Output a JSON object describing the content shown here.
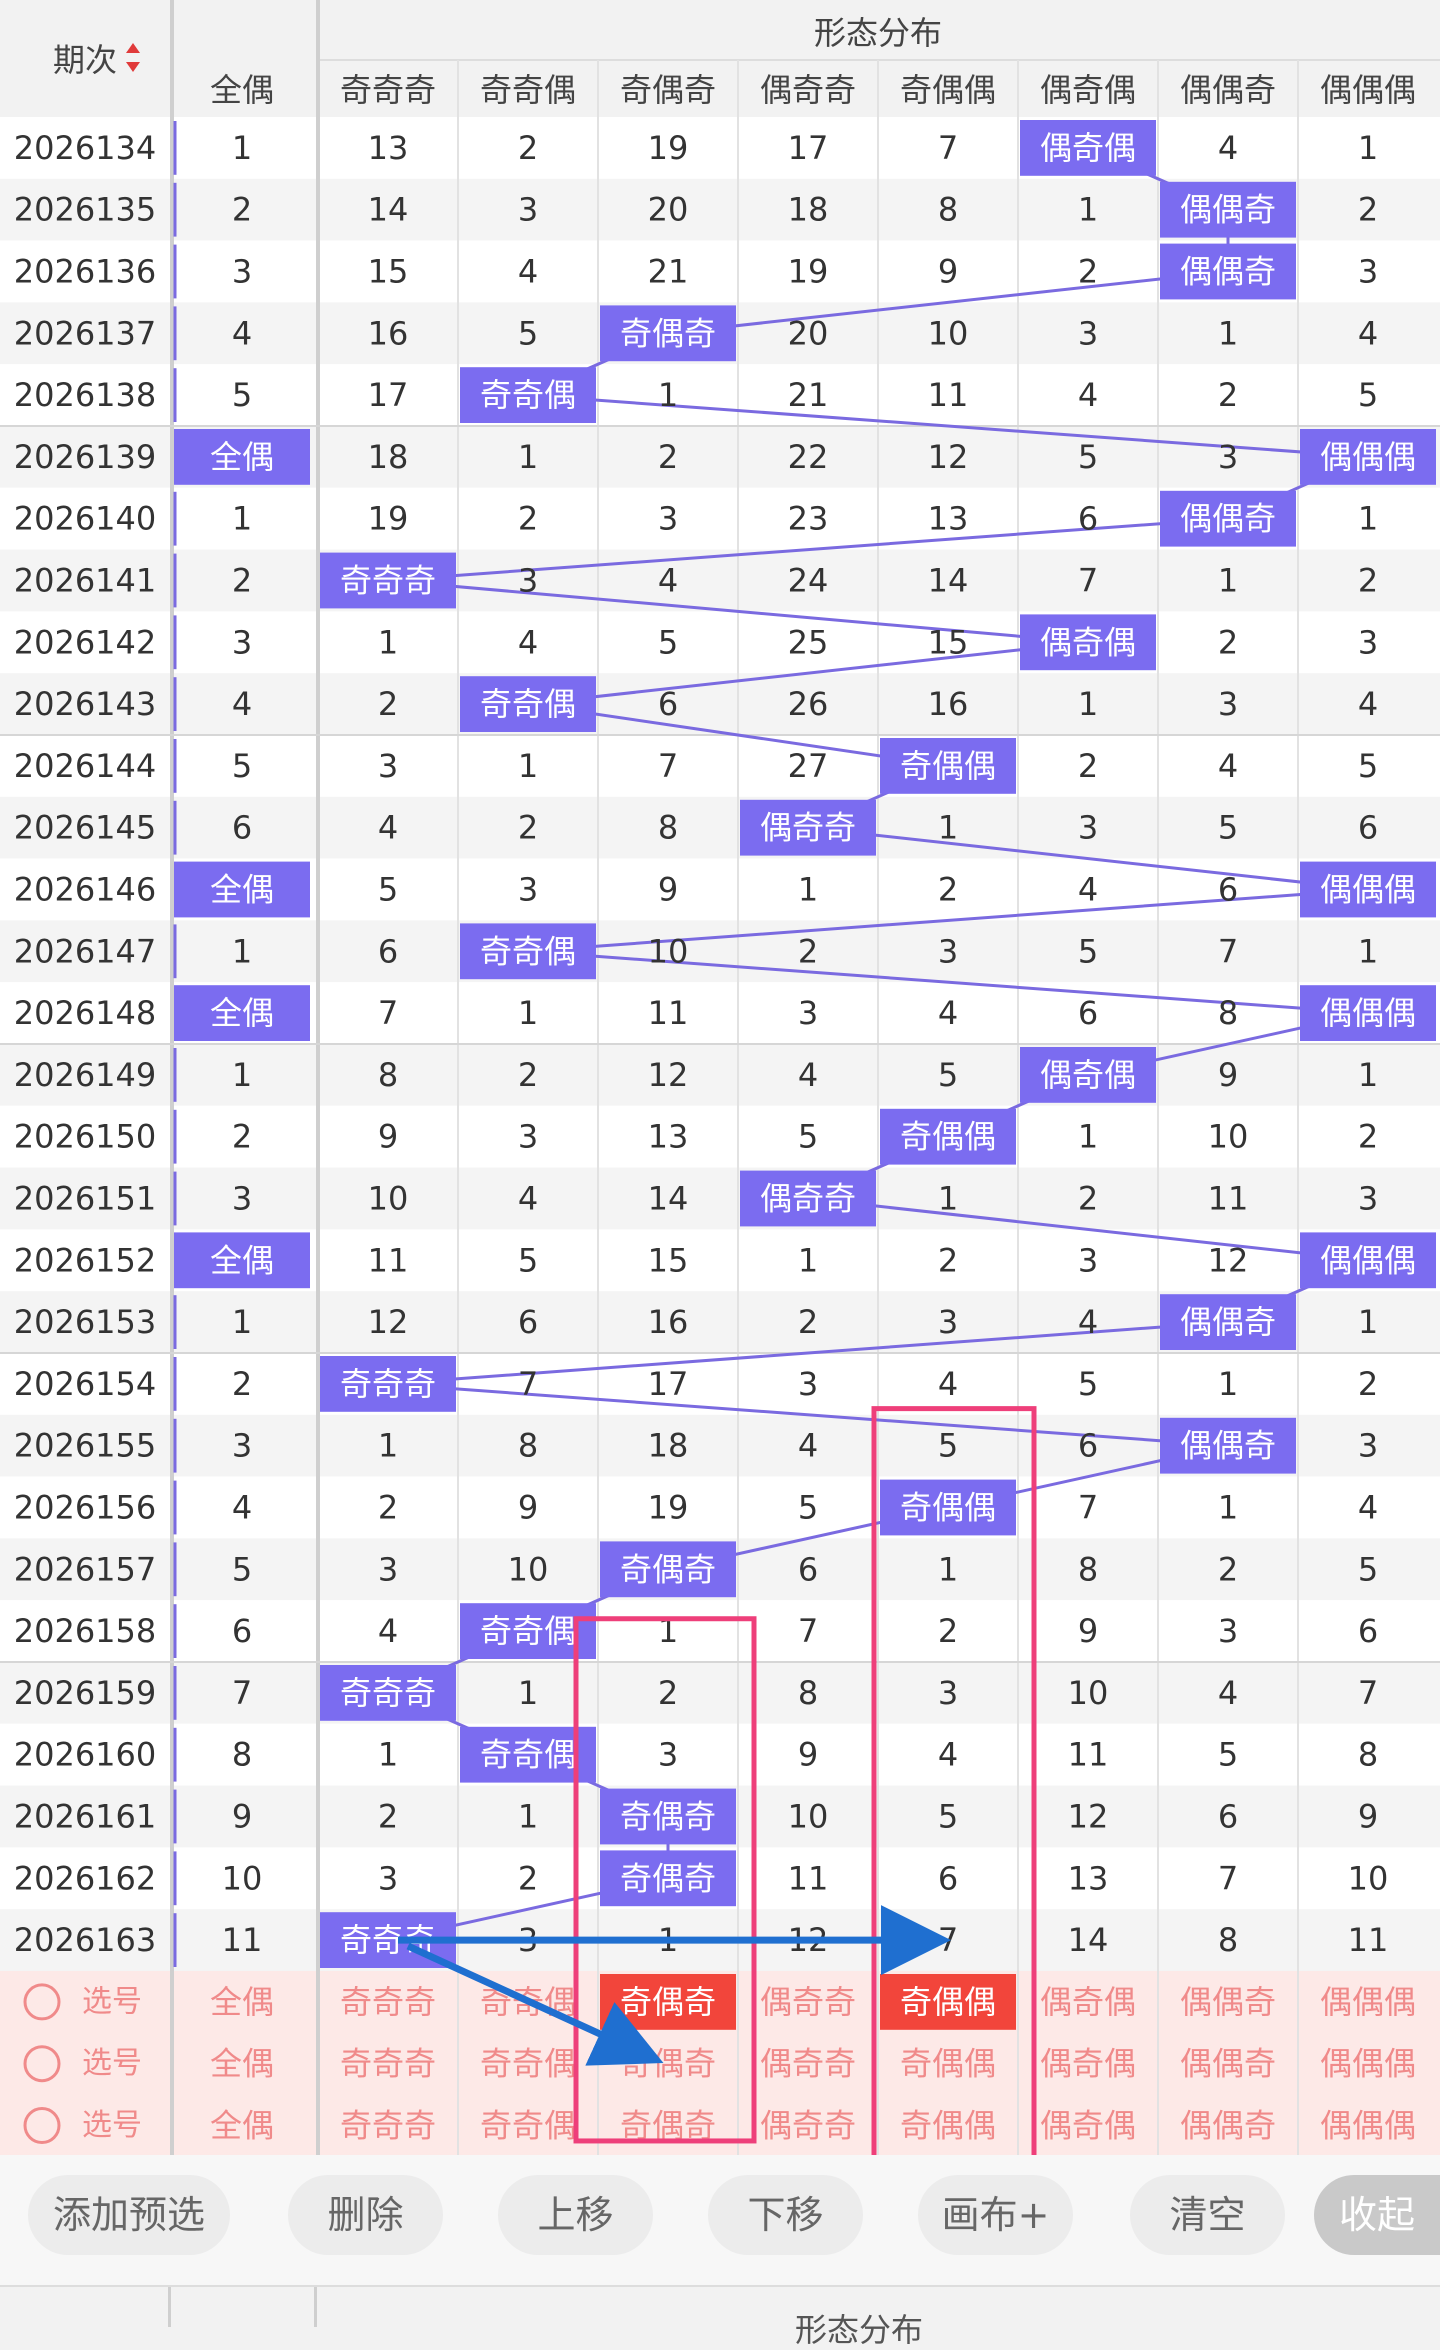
{
  "header": {
    "period_label": "期次",
    "group_label": "形态分布",
    "columns": [
      "全偶",
      "奇奇奇",
      "奇奇偶",
      "奇偶奇",
      "偶奇奇",
      "奇偶偶",
      "偶奇偶",
      "偶偶奇",
      "偶偶偶"
    ]
  },
  "rows": [
    {
      "period": "2026134",
      "cells": [
        "1",
        "13",
        "2",
        "19",
        "17",
        "7",
        "偶奇偶",
        "4",
        "1"
      ]
    },
    {
      "period": "2026135",
      "cells": [
        "2",
        "14",
        "3",
        "20",
        "18",
        "8",
        "1",
        "偶偶奇",
        "2"
      ]
    },
    {
      "period": "2026136",
      "cells": [
        "3",
        "15",
        "4",
        "21",
        "19",
        "9",
        "2",
        "偶偶奇",
        "3"
      ]
    },
    {
      "period": "2026137",
      "cells": [
        "4",
        "16",
        "5",
        "奇偶奇",
        "20",
        "10",
        "3",
        "1",
        "4"
      ]
    },
    {
      "period": "2026138",
      "cells": [
        "5",
        "17",
        "奇奇偶",
        "1",
        "21",
        "11",
        "4",
        "2",
        "5"
      ]
    },
    {
      "period": "2026139",
      "cells": [
        "全偶",
        "18",
        "1",
        "2",
        "22",
        "12",
        "5",
        "3",
        "偶偶偶"
      ]
    },
    {
      "period": "2026140",
      "cells": [
        "1",
        "19",
        "2",
        "3",
        "23",
        "13",
        "6",
        "偶偶奇",
        "1"
      ]
    },
    {
      "period": "2026141",
      "cells": [
        "2",
        "奇奇奇",
        "3",
        "4",
        "24",
        "14",
        "7",
        "1",
        "2"
      ]
    },
    {
      "period": "2026142",
      "cells": [
        "3",
        "1",
        "4",
        "5",
        "25",
        "15",
        "偶奇偶",
        "2",
        "3"
      ]
    },
    {
      "period": "2026143",
      "cells": [
        "4",
        "2",
        "奇奇偶",
        "6",
        "26",
        "16",
        "1",
        "3",
        "4"
      ]
    },
    {
      "period": "2026144",
      "cells": [
        "5",
        "3",
        "1",
        "7",
        "27",
        "奇偶偶",
        "2",
        "4",
        "5"
      ]
    },
    {
      "period": "2026145",
      "cells": [
        "6",
        "4",
        "2",
        "8",
        "偶奇奇",
        "1",
        "3",
        "5",
        "6"
      ]
    },
    {
      "period": "2026146",
      "cells": [
        "全偶",
        "5",
        "3",
        "9",
        "1",
        "2",
        "4",
        "6",
        "偶偶偶"
      ]
    },
    {
      "period": "2026147",
      "cells": [
        "1",
        "6",
        "奇奇偶",
        "10",
        "2",
        "3",
        "5",
        "7",
        "1"
      ]
    },
    {
      "period": "2026148",
      "cells": [
        "全偶",
        "7",
        "1",
        "11",
        "3",
        "4",
        "6",
        "8",
        "偶偶偶"
      ]
    },
    {
      "period": "2026149",
      "cells": [
        "1",
        "8",
        "2",
        "12",
        "4",
        "5",
        "偶奇偶",
        "9",
        "1"
      ]
    },
    {
      "period": "2026150",
      "cells": [
        "2",
        "9",
        "3",
        "13",
        "5",
        "奇偶偶",
        "1",
        "10",
        "2"
      ]
    },
    {
      "period": "2026151",
      "cells": [
        "3",
        "10",
        "4",
        "14",
        "偶奇奇",
        "1",
        "2",
        "11",
        "3"
      ]
    },
    {
      "period": "2026152",
      "cells": [
        "全偶",
        "11",
        "5",
        "15",
        "1",
        "2",
        "3",
        "12",
        "偶偶偶"
      ]
    },
    {
      "period": "2026153",
      "cells": [
        "1",
        "12",
        "6",
        "16",
        "2",
        "3",
        "4",
        "偶偶奇",
        "1"
      ]
    },
    {
      "period": "2026154",
      "cells": [
        "2",
        "奇奇奇",
        "7",
        "17",
        "3",
        "4",
        "5",
        "1",
        "2"
      ]
    },
    {
      "period": "2026155",
      "cells": [
        "3",
        "1",
        "8",
        "18",
        "4",
        "5",
        "6",
        "偶偶奇",
        "3"
      ]
    },
    {
      "period": "2026156",
      "cells": [
        "4",
        "2",
        "9",
        "19",
        "5",
        "奇偶偶",
        "7",
        "1",
        "4"
      ]
    },
    {
      "period": "2026157",
      "cells": [
        "5",
        "3",
        "10",
        "奇偶奇",
        "6",
        "1",
        "8",
        "2",
        "5"
      ]
    },
    {
      "period": "2026158",
      "cells": [
        "6",
        "4",
        "奇奇偶",
        "1",
        "7",
        "2",
        "9",
        "3",
        "6"
      ]
    },
    {
      "period": "2026159",
      "cells": [
        "7",
        "奇奇奇",
        "1",
        "2",
        "8",
        "3",
        "10",
        "4",
        "7"
      ]
    },
    {
      "period": "2026160",
      "cells": [
        "8",
        "1",
        "奇奇偶",
        "3",
        "9",
        "4",
        "11",
        "5",
        "8"
      ]
    },
    {
      "period": "2026161",
      "cells": [
        "9",
        "2",
        "1",
        "奇偶奇",
        "10",
        "5",
        "12",
        "6",
        "9"
      ]
    },
    {
      "period": "2026162",
      "cells": [
        "10",
        "3",
        "2",
        "奇偶奇",
        "11",
        "6",
        "13",
        "7",
        "10"
      ]
    },
    {
      "period": "2026163",
      "cells": [
        "11",
        "奇奇奇",
        "3",
        "1",
        "12",
        "7",
        "14",
        "8",
        "11"
      ]
    }
  ],
  "select_rows": [
    {
      "label": "选号",
      "highlight": [
        3,
        5
      ]
    },
    {
      "label": "选号",
      "highlight": []
    },
    {
      "label": "选号",
      "highlight": []
    }
  ],
  "buttons": {
    "add": "添加预选",
    "delete": "删除",
    "up": "上移",
    "down": "下移",
    "canvas": "画布+",
    "clear": "清空",
    "collapse": "收起"
  },
  "bottom_header": {
    "group_label": "形态分布"
  },
  "colors": {
    "hit_fill": "#7b6cf0",
    "line": "#7a6ae0",
    "select_bg": "#fde9e7",
    "select_text": "#f08a8a",
    "select_hit": "#f2453b",
    "annotation_box": "#ee3f7a",
    "annotation_arrow": "#1f6fd0"
  }
}
